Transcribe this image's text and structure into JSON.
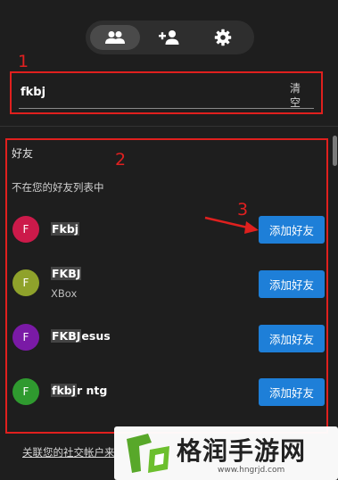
{
  "tabs": [
    {
      "icon": "friends-icon",
      "active": true
    },
    {
      "icon": "add-friend-icon",
      "active": false
    },
    {
      "icon": "gear-icon",
      "active": false
    }
  ],
  "annotations": [
    "1",
    "2",
    "3"
  ],
  "search": {
    "value": "fkbj",
    "clear_label": "清空"
  },
  "results": {
    "section_title": "好友",
    "subtitle": "不在您的好友列表中",
    "add_label": "添加好友",
    "items": [
      {
        "initial": "F",
        "avatar_color": "#cc1a4a",
        "name_match": "Fkbj",
        "name_rest": "",
        "sub": ""
      },
      {
        "initial": "F",
        "avatar_color": "#8fa22b",
        "name_match": "FKBJ",
        "name_rest": "",
        "sub": "XBox"
      },
      {
        "initial": "F",
        "avatar_color": "#7a1aa6",
        "name_match": "FKBJ",
        "name_rest": "esus",
        "sub": ""
      },
      {
        "initial": "F",
        "avatar_color": "#2f9a2f",
        "name_match": "fkbj",
        "name_rest": "r ntg",
        "sub": ""
      }
    ]
  },
  "bottom_link": "关联您的社交帐户来",
  "watermark": {
    "text": "格润手游网",
    "url": "www.hngrjd.com"
  },
  "colors": {
    "accent": "#1e7fd8",
    "annotation": "#e0201e",
    "background": "#1e1e1e"
  }
}
